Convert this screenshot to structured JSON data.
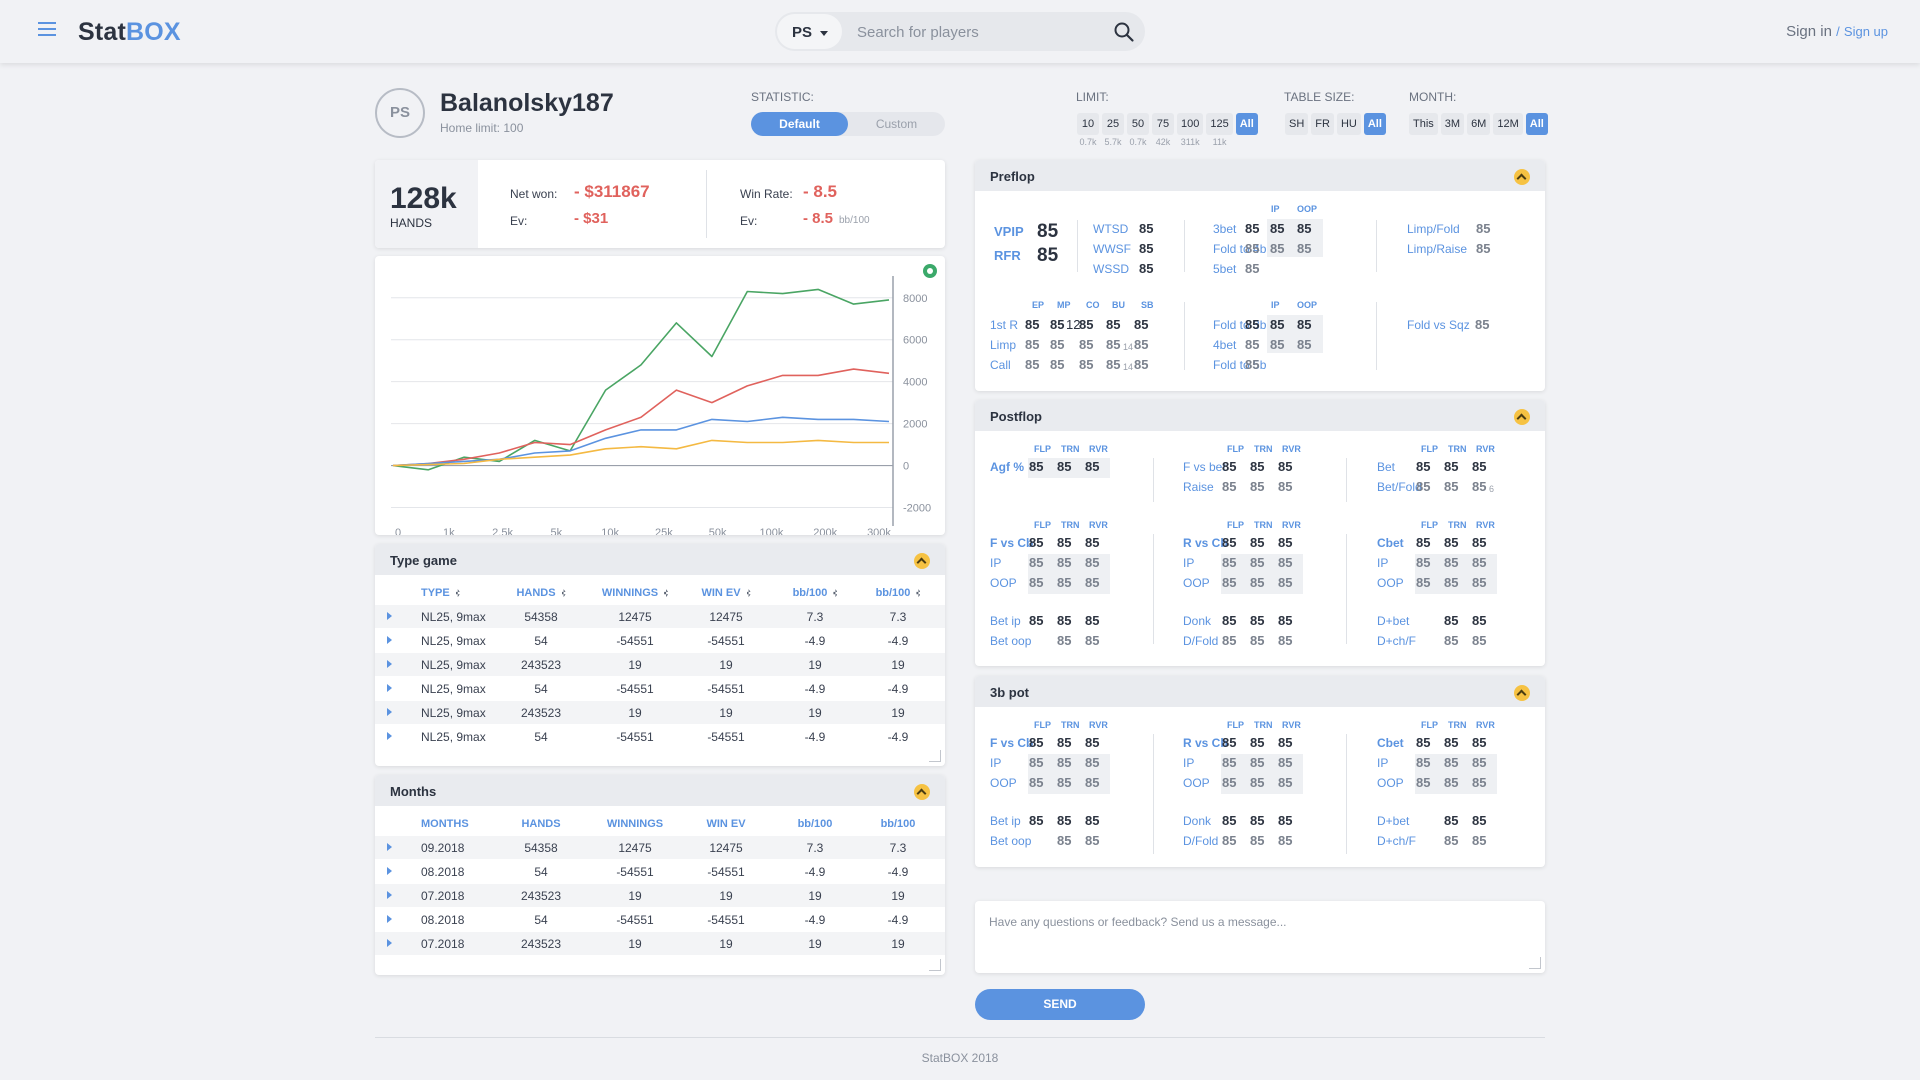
{
  "header": {
    "logo_a": "Stat",
    "logo_b": "BOX",
    "site_select": "PS",
    "search_placeholder": "Search for players",
    "signin": "Sign in",
    "slash": "/",
    "signup": "Sign up"
  },
  "player": {
    "avatar": "PS",
    "name": "Balanolsky187",
    "home_limit": "Home limit: 100"
  },
  "filters": {
    "statistic_label": "STATISTIC:",
    "stat_default": "Default",
    "stat_custom": "Custom",
    "limit_label": "LIMIT:",
    "limits": [
      {
        "label": "10",
        "sub": "0.7k"
      },
      {
        "label": "25",
        "sub": "5.7k"
      },
      {
        "label": "50",
        "sub": "0.7k"
      },
      {
        "label": "75",
        "sub": "42k"
      },
      {
        "label": "100",
        "sub": "311k"
      },
      {
        "label": "125",
        "sub": "11k"
      },
      {
        "label": "All",
        "sub": ""
      }
    ],
    "table_size_label": "TABLE SIZE:",
    "table_sizes": [
      "SH",
      "FR",
      "HU",
      "All"
    ],
    "month_label": "MONTH:",
    "months": [
      "This",
      "3M",
      "6M",
      "12M",
      "All"
    ]
  },
  "summary": {
    "hands": "128k",
    "hands_label": "HANDS",
    "net_won_label": "Net won:",
    "net_won": "- $311867",
    "ev_label": "Ev:",
    "ev": "- $31",
    "win_rate_label": "Win Rate:",
    "win_rate": "- 8.5",
    "ev2_label": "Ev:",
    "ev2": "- 8.5",
    "ev2_unit": "bb/100"
  },
  "chart_data": {
    "type": "line",
    "x": [
      "0",
      "1k",
      "2.5k",
      "5k",
      "10k",
      "25k",
      "50k",
      "100k",
      "200k",
      "300k"
    ],
    "yticks": [
      8000,
      6000,
      4000,
      2000,
      0,
      -2000
    ],
    "ylim": [
      -2500,
      8800
    ],
    "grid": true,
    "colors": {
      "green": "#4aa564",
      "red": "#e0625d",
      "blue": "#5b93e0",
      "yellow": "#f4b942"
    },
    "series": [
      {
        "color": "green",
        "values": [
          0,
          -200,
          400,
          200,
          1200,
          700,
          3600,
          4800,
          6800,
          5200,
          8300,
          8200,
          8400,
          7700,
          7900
        ]
      },
      {
        "color": "red",
        "values": [
          0,
          100,
          300,
          600,
          1100,
          1000,
          1700,
          2300,
          3600,
          3000,
          3800,
          4300,
          4300,
          4600,
          4400
        ]
      },
      {
        "color": "blue",
        "values": [
          0,
          100,
          200,
          300,
          600,
          700,
          1300,
          1700,
          1700,
          2200,
          2100,
          2300,
          2200,
          2200,
          2100
        ]
      },
      {
        "color": "yellow",
        "values": [
          0,
          50,
          100,
          300,
          400,
          500,
          800,
          900,
          800,
          1200,
          1100,
          1100,
          1200,
          1100,
          1100
        ]
      }
    ]
  },
  "type_game": {
    "title": "Type game",
    "headers": [
      "TYPE",
      "HANDS",
      "WINNINGS",
      "WIN EV",
      "bb/100",
      "bb/100"
    ],
    "rows": [
      [
        "NL25, 9max",
        "54358",
        "12475",
        "12475",
        "7.3",
        "7.3"
      ],
      [
        "NL25, 9max",
        "54",
        "-54551",
        "-54551",
        "-4.9",
        "-4.9"
      ],
      [
        "NL25, 9max",
        "243523",
        "19",
        "19",
        "19",
        "19"
      ],
      [
        "NL25, 9max",
        "54",
        "-54551",
        "-54551",
        "-4.9",
        "-4.9"
      ],
      [
        "NL25, 9max",
        "243523",
        "19",
        "19",
        "19",
        "19"
      ],
      [
        "NL25, 9max",
        "54",
        "-54551",
        "-54551",
        "-4.9",
        "-4.9"
      ]
    ]
  },
  "months_table": {
    "title": "Months",
    "headers": [
      "MONTHS",
      "HANDS",
      "WINNINGS",
      "WIN EV",
      "bb/100",
      "bb/100"
    ],
    "rows": [
      [
        "09.2018",
        "54358",
        "12475",
        "12475",
        "7.3",
        "7.3"
      ],
      [
        "08.2018",
        "54",
        "-54551",
        "-54551",
        "-4.9",
        "-4.9"
      ],
      [
        "07.2018",
        "243523",
        "19",
        "19",
        "19",
        "19"
      ],
      [
        "08.2018",
        "54",
        "-54551",
        "-54551",
        "-4.9",
        "-4.9"
      ],
      [
        "07.2018",
        "243523",
        "19",
        "19",
        "19",
        "19"
      ]
    ]
  },
  "preflop": {
    "title": "Preflop",
    "vpip": "VPIP",
    "vpip_v": "85",
    "rfr": "RFR",
    "rfr_v": "85",
    "wtsd": "WTSD",
    "wwsf": "WWSF",
    "wssd": "WSSD",
    "ip": "IP",
    "oop": "OOP",
    "bet3": "3bet",
    "fold4": "Fold to 4b",
    "bet5": "5bet",
    "limpfold": "Limp/Fold",
    "limpraise": "Limp/Raise",
    "positions": [
      "EP",
      "MP",
      "CO",
      "BU",
      "SB"
    ],
    "r1": "1st R",
    "limp": "Limp",
    "call": "Call",
    "fold3": "Fold to 3b",
    "bet4": "4bet",
    "fold5": "Fold to 5b",
    "foldsqz": "Fold vs Sqz",
    "v": "85",
    "mp_sub": "12",
    "sub14": "14"
  },
  "postflop": {
    "title": "Postflop",
    "flp": "FLP",
    "trn": "TRN",
    "rvr": "RVR",
    "agf": "Agf %",
    "fvsbet": "F vs bet",
    "raise": "Raise",
    "bet": "Bet",
    "betfold": "Bet/Fold",
    "fvscb": "F vs Cb",
    "rvscb": "R vs Cb",
    "cbet": "Cbet",
    "ip": "IP",
    "oop": "OOP",
    "betip": "Bet ip",
    "betoop": "Bet oop",
    "donk": "Donk",
    "dfold": "D/Fold",
    "dbet": "D+bet",
    "dchf": "D+ch/F",
    "v": "85",
    "sub6": "6"
  },
  "pot3b": {
    "title": "3b pot"
  },
  "feedback": {
    "placeholder": "Have any questions or feedback? Send us a message...",
    "send": "SEND"
  },
  "footer": "StatBOX 2018"
}
